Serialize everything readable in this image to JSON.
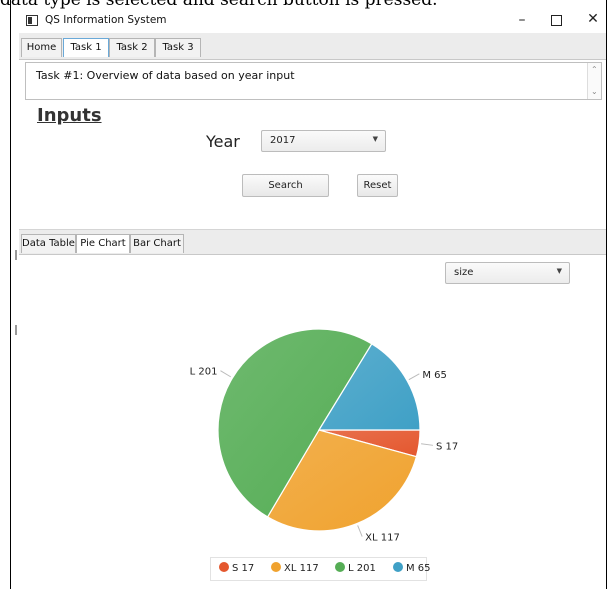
{
  "background_text": "data type is selected and search button is pressed.",
  "window": {
    "title": "QS Information System",
    "minimize": "–",
    "close": "✕",
    "icon": "app-window-icon"
  },
  "tabs": [
    {
      "label": "Home",
      "active": false
    },
    {
      "label": "Task 1",
      "active": true
    },
    {
      "label": "Task 2",
      "active": false
    },
    {
      "label": "Task 3",
      "active": false
    }
  ],
  "description": "Task #1: Overview of data based on year input",
  "inputs": {
    "heading": "Inputs",
    "year_label": "Year",
    "year_value": "2017",
    "search_label": "Search",
    "reset_label": "Reset"
  },
  "subtabs": [
    {
      "label": "Data Table",
      "active": false
    },
    {
      "label": "Pie Chart",
      "active": true
    },
    {
      "label": "Bar Chart",
      "active": false
    }
  ],
  "chart_selector": {
    "value": "size"
  },
  "chart_data": {
    "type": "pie",
    "slices": [
      {
        "name": "S",
        "value": 17,
        "label": "S 17",
        "color": "#e4572e"
      },
      {
        "name": "XL",
        "value": 117,
        "label": "XL 117",
        "color": "#f0a22e"
      },
      {
        "name": "L",
        "value": 201,
        "label": "L 201",
        "color": "#55ad55"
      },
      {
        "name": "M",
        "value": 65,
        "label": "M 65",
        "color": "#3fa0c6"
      }
    ],
    "legend": [
      "S 17",
      "XL 117",
      "L 201",
      "M 65"
    ],
    "legend_position": "bottom"
  }
}
